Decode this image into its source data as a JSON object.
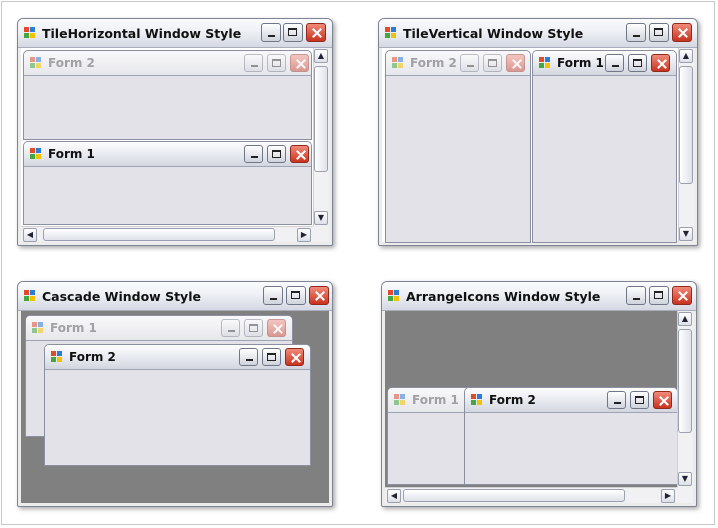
{
  "windows": [
    {
      "title": "TileHorizontal Window Style",
      "children": [
        {
          "title": "Form 2"
        },
        {
          "title": "Form 1"
        }
      ]
    },
    {
      "title": "TileVertical Window Style",
      "children": [
        {
          "title": "Form 2"
        },
        {
          "title": "Form 1"
        }
      ]
    },
    {
      "title": "Cascade Window Style",
      "children": [
        {
          "title": "Form 1"
        },
        {
          "title": "Form 2"
        }
      ]
    },
    {
      "title": "ArrangeIcons Window Style",
      "children": [
        {
          "title": "Form 1"
        },
        {
          "title": "Form 2"
        }
      ]
    }
  ],
  "icons": {
    "app": "mdi-app-icon",
    "minimize": "minimize-icon",
    "maximize": "maximize-icon",
    "close": "close-icon"
  },
  "colors": {
    "mdi_background": "#808080",
    "child_client": "#e2e2e8",
    "close_button": "#c9331f"
  }
}
